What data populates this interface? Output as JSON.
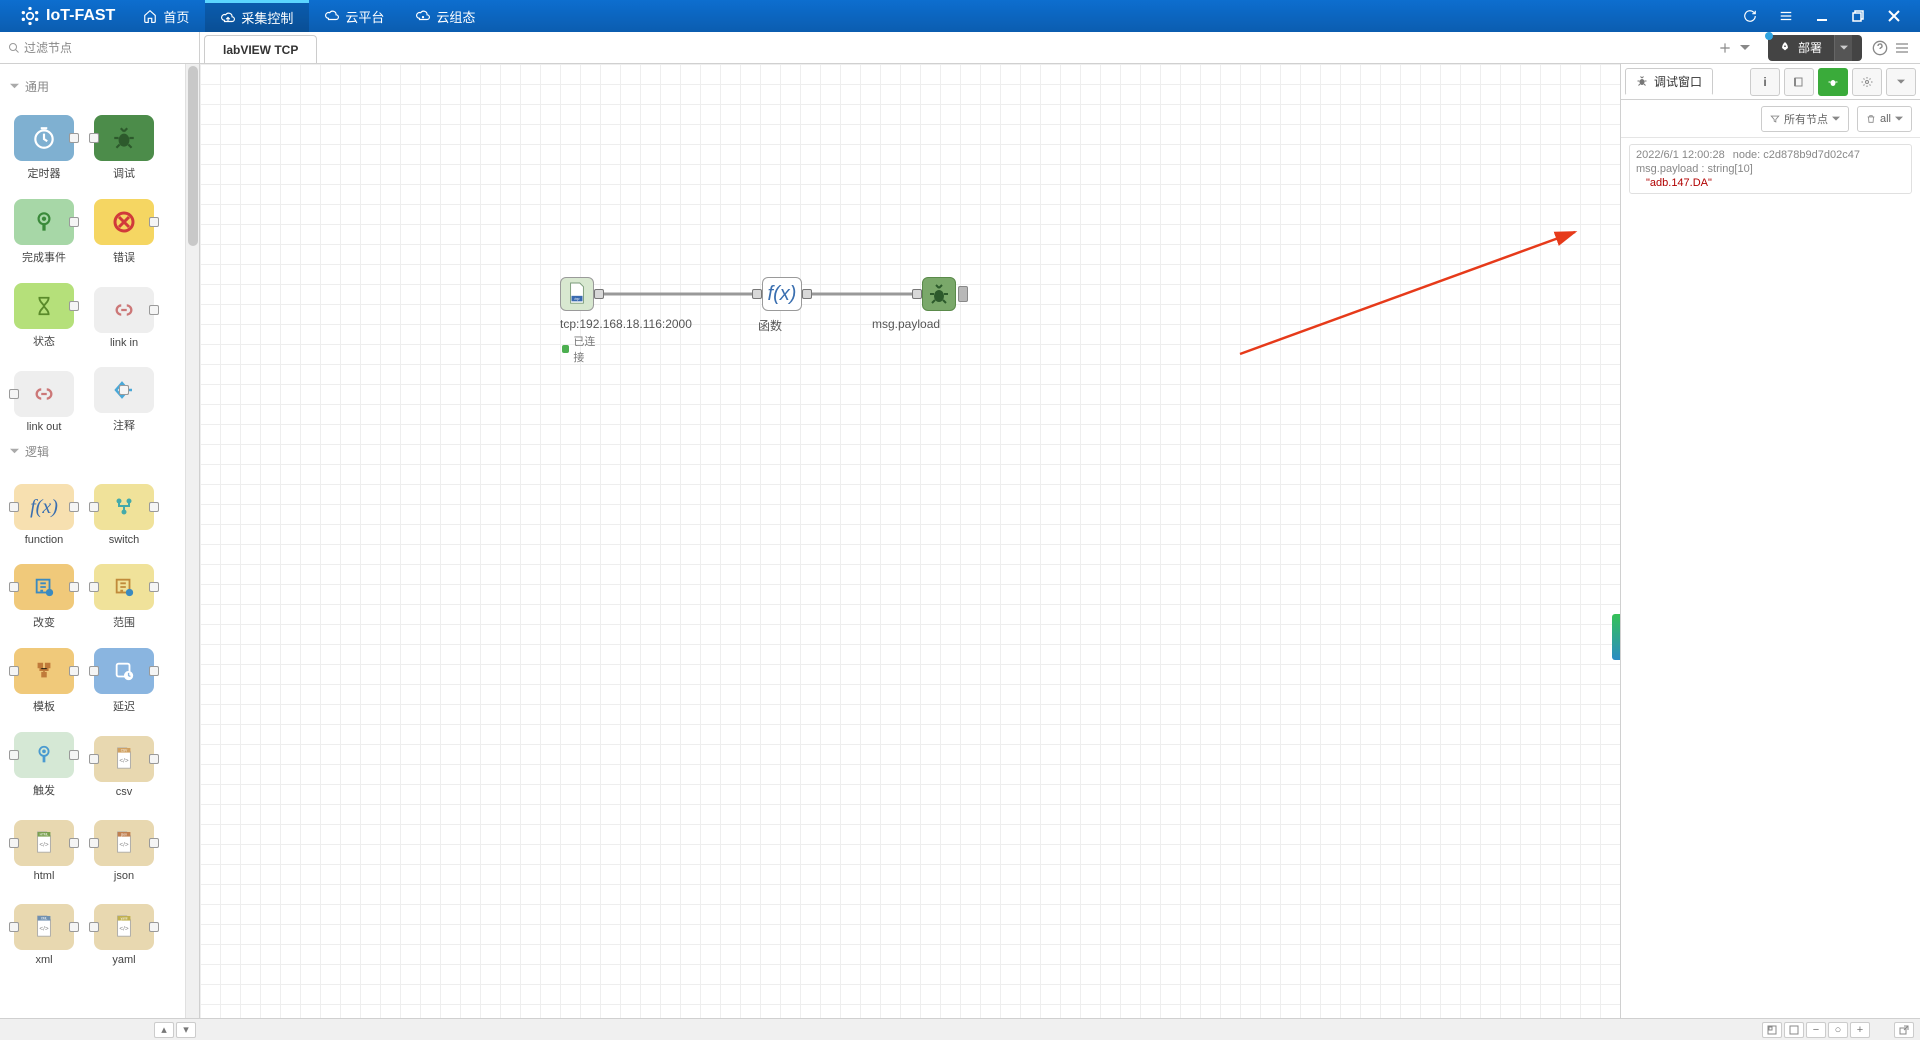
{
  "app": {
    "title": "IoT-FAST"
  },
  "topmenu": {
    "home": "首页",
    "collect": "采集控制",
    "cloud": "云平台",
    "cloudcfg": "云组态"
  },
  "search": {
    "placeholder": "过滤节点"
  },
  "tabs": {
    "flow1": "labVIEW TCP"
  },
  "deploy": {
    "label": "部署"
  },
  "toolbar": {
    "help": "?",
    "menu": "≡"
  },
  "palette": {
    "cat_common": "通用",
    "cat_logic": "逻辑",
    "inject": "定时器",
    "debug": "调试",
    "complete": "完成事件",
    "catch": "错误",
    "status": "状态",
    "linkin": "link in",
    "linkout": "link out",
    "comment": "注释",
    "function": "function",
    "switch": "switch",
    "change": "改变",
    "range": "范围",
    "template": "模板",
    "delay": "延迟",
    "trigger": "触发",
    "csv": "csv",
    "html": "html",
    "json": "json",
    "xml": "xml",
    "yaml": "yaml"
  },
  "flow": {
    "tcp_label": "tcp:192.168.18.116:2000",
    "tcp_status": "已连接",
    "func_label": "函数",
    "func_icon": "f(x)",
    "debug_label": "msg.payload"
  },
  "sidebar": {
    "debug_title": "调试窗口",
    "filter_all_nodes": "所有节点",
    "filter_all": "all"
  },
  "debug": {
    "time": "2022/6/1 12:00:28",
    "node_prefix": "node:",
    "node": "c2d878b9d7d02c47",
    "path": "msg.payload : string[10]",
    "value": "\"adb.147.DA\""
  }
}
